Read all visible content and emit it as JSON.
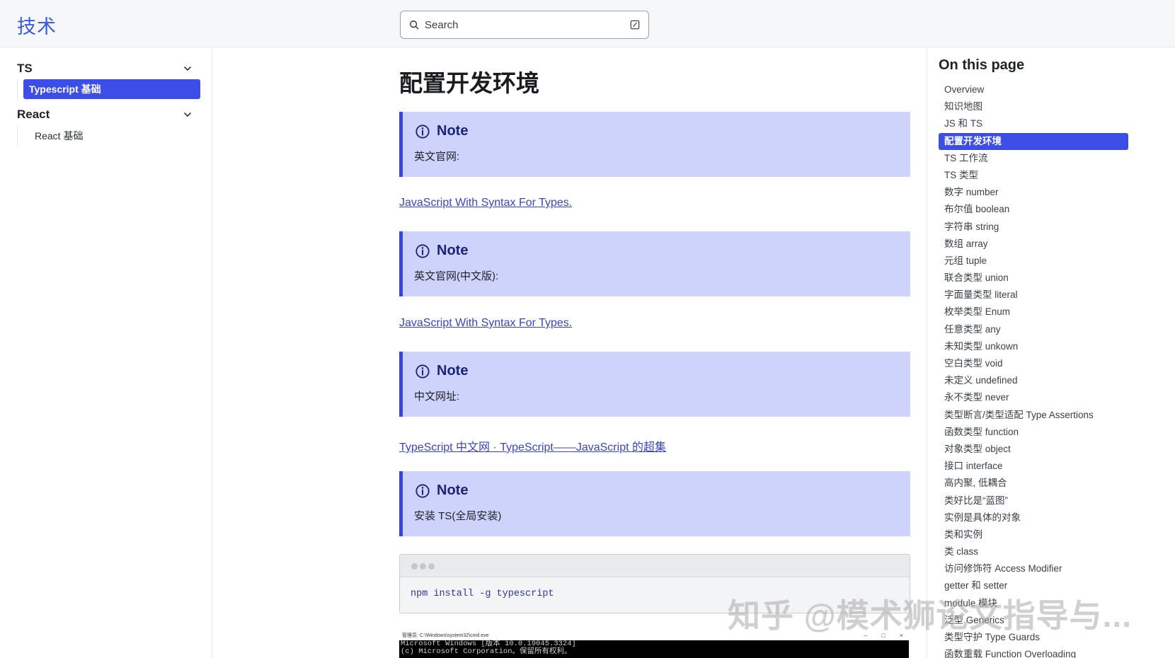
{
  "header": {
    "brand": "技术",
    "search_placeholder": "Search"
  },
  "sidebar": {
    "groups": [
      {
        "title": "TS",
        "items": [
          {
            "label": "Typescript 基础",
            "active": true
          }
        ]
      },
      {
        "title": "React",
        "items": [
          {
            "label": "React 基础",
            "active": false
          }
        ]
      }
    ]
  },
  "main": {
    "title": "配置开发环境",
    "notes": [
      {
        "title": "Note",
        "body": "英文官网:"
      },
      {
        "title": "Note",
        "body": "英文官网(中文版):"
      },
      {
        "title": "Note",
        "body": "中文网址:"
      },
      {
        "title": "Note",
        "body": "安装 TS(全局安装)"
      }
    ],
    "links": [
      "JavaScript With Syntax For Types.",
      "JavaScript With Syntax For Types.",
      "TypeScript 中文网 · TypeScript——JavaScript 的超集"
    ],
    "code": "npm install -g typescript",
    "cmd": {
      "title": "管理员: C:\\Windows\\system32\\cmd.exe",
      "lines": [
        "Microsoft Windows [版本 10.0.19045.3324]",
        "(c) Microsoft Corporation。保留所有权利。"
      ]
    }
  },
  "toc": {
    "title": "On this page",
    "items": [
      "Overview",
      "知识地图",
      "JS 和 TS",
      "配置开发环境",
      "TS 工作流",
      "TS 类型",
      "数字 number",
      "布尔值 boolean",
      "字符串 string",
      "数组 array",
      "元组 tuple",
      "联合类型 union",
      "字面量类型 literal",
      "枚举类型 Enum",
      "任意类型 any",
      "未知类型 unkown",
      "空白类型 void",
      "未定义 undefined",
      "永不类型 never",
      "类型断言/类型适配 Type Assertions",
      "函数类型 function",
      "对象类型 object",
      "接口 interface",
      "高内聚, 低耦合",
      "类好比是“蓝图”",
      "实例是具体的对象",
      "类和实例",
      "类 class",
      "访问修饰符 Access Modifier",
      "getter 和 setter",
      "module 模块",
      "泛型 Generics",
      "类型守护 Type Guards",
      "函数重载 Function Overloading"
    ],
    "active_index": 3
  },
  "watermark": "知乎 @模术狮论文指导与..."
}
